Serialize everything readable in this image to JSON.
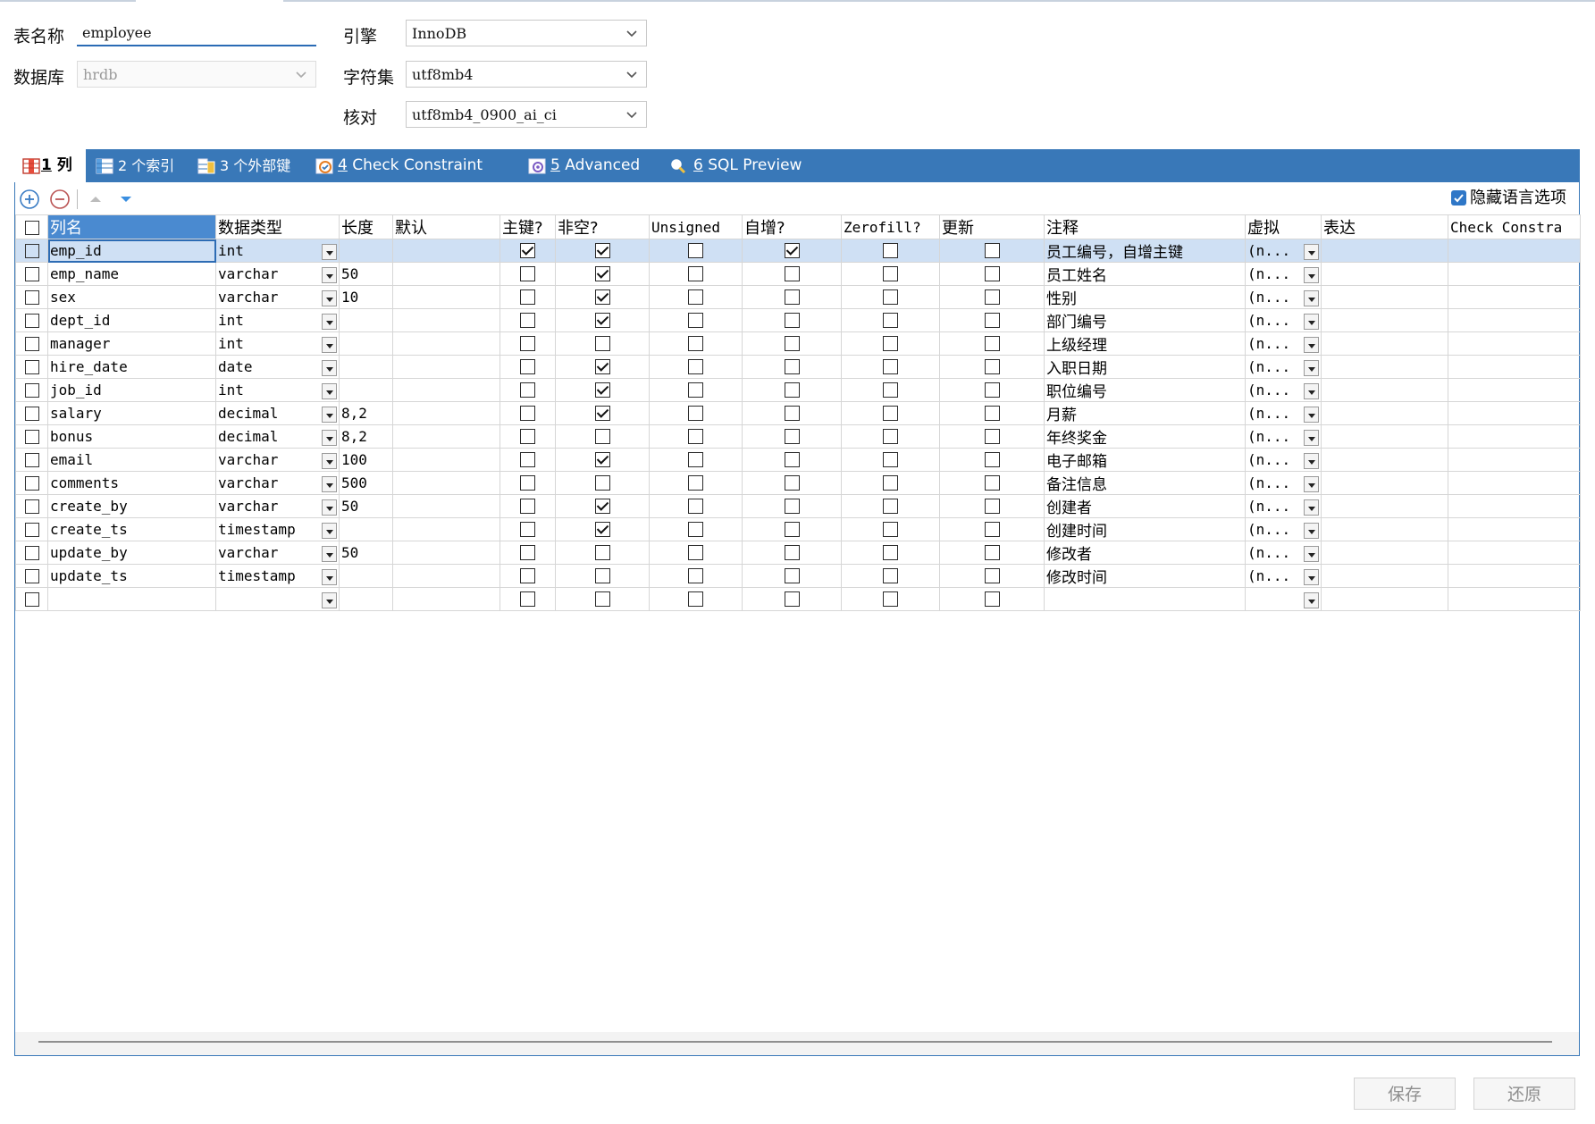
{
  "form": {
    "table_name_label": "表名称",
    "table_name_value": "employee",
    "database_label": "数据库",
    "database_value": "hrdb",
    "engine_label": "引擎",
    "engine_value": "InnoDB",
    "charset_label": "字符集",
    "charset_value": "utf8mb4",
    "collation_label": "核对",
    "collation_value": "utf8mb4_0900_ai_ci"
  },
  "tabs": [
    {
      "num": "1",
      "label": " 列",
      "icon": "columns-icon"
    },
    {
      "num": "2",
      "label": " 个索引",
      "icon": "index-icon"
    },
    {
      "num": "3",
      "label": " 个外部键",
      "icon": "foreign-key-icon"
    },
    {
      "num": "4",
      "label": " Check Constraint",
      "icon": "check-constraint-icon"
    },
    {
      "num": "5",
      "label": " Advanced",
      "icon": "advanced-icon"
    },
    {
      "num": "6",
      "label": " SQL Preview",
      "icon": "sql-preview-icon"
    }
  ],
  "toolbar": {
    "hide_lang_label": "隐藏语言选项",
    "hide_lang_checked": true
  },
  "columns_header": [
    "列名",
    "数据类型",
    "长度",
    "默认",
    "主键?",
    "非空?",
    "Unsigned",
    "自增?",
    "Zerofill?",
    "更新",
    "注释",
    "虚拟",
    "表达",
    "Check Constra"
  ],
  "rows": [
    {
      "name": "emp_id",
      "type": "int",
      "len": "",
      "def": "",
      "pk": true,
      "nn": true,
      "uns": false,
      "ai": true,
      "zf": false,
      "upd": false,
      "comment": "员工编号，自增主键",
      "virtual": "(n..."
    },
    {
      "name": "emp_name",
      "type": "varchar",
      "len": "50",
      "def": "",
      "pk": false,
      "nn": true,
      "uns": false,
      "ai": false,
      "zf": false,
      "upd": false,
      "comment": "员工姓名",
      "virtual": "(n..."
    },
    {
      "name": "sex",
      "type": "varchar",
      "len": "10",
      "def": "",
      "pk": false,
      "nn": true,
      "uns": false,
      "ai": false,
      "zf": false,
      "upd": false,
      "comment": "性别",
      "virtual": "(n..."
    },
    {
      "name": "dept_id",
      "type": "int",
      "len": "",
      "def": "",
      "pk": false,
      "nn": true,
      "uns": false,
      "ai": false,
      "zf": false,
      "upd": false,
      "comment": "部门编号",
      "virtual": "(n..."
    },
    {
      "name": "manager",
      "type": "int",
      "len": "",
      "def": "",
      "pk": false,
      "nn": false,
      "uns": false,
      "ai": false,
      "zf": false,
      "upd": false,
      "comment": "上级经理",
      "virtual": "(n..."
    },
    {
      "name": "hire_date",
      "type": "date",
      "len": "",
      "def": "",
      "pk": false,
      "nn": true,
      "uns": false,
      "ai": false,
      "zf": false,
      "upd": false,
      "comment": "入职日期",
      "virtual": "(n..."
    },
    {
      "name": "job_id",
      "type": "int",
      "len": "",
      "def": "",
      "pk": false,
      "nn": true,
      "uns": false,
      "ai": false,
      "zf": false,
      "upd": false,
      "comment": "职位编号",
      "virtual": "(n..."
    },
    {
      "name": "salary",
      "type": "decimal",
      "len": "8,2",
      "def": "",
      "pk": false,
      "nn": true,
      "uns": false,
      "ai": false,
      "zf": false,
      "upd": false,
      "comment": "月薪",
      "virtual": "(n..."
    },
    {
      "name": "bonus",
      "type": "decimal",
      "len": "8,2",
      "def": "",
      "pk": false,
      "nn": false,
      "uns": false,
      "ai": false,
      "zf": false,
      "upd": false,
      "comment": "年终奖金",
      "virtual": "(n..."
    },
    {
      "name": "email",
      "type": "varchar",
      "len": "100",
      "def": "",
      "pk": false,
      "nn": true,
      "uns": false,
      "ai": false,
      "zf": false,
      "upd": false,
      "comment": "电子邮箱",
      "virtual": "(n..."
    },
    {
      "name": "comments",
      "type": "varchar",
      "len": "500",
      "def": "",
      "pk": false,
      "nn": false,
      "uns": false,
      "ai": false,
      "zf": false,
      "upd": false,
      "comment": "备注信息",
      "virtual": "(n..."
    },
    {
      "name": "create_by",
      "type": "varchar",
      "len": "50",
      "def": "",
      "pk": false,
      "nn": true,
      "uns": false,
      "ai": false,
      "zf": false,
      "upd": false,
      "comment": "创建者",
      "virtual": "(n..."
    },
    {
      "name": "create_ts",
      "type": "timestamp",
      "len": "",
      "def": "",
      "pk": false,
      "nn": true,
      "uns": false,
      "ai": false,
      "zf": false,
      "upd": false,
      "comment": "创建时间",
      "virtual": "(n..."
    },
    {
      "name": "update_by",
      "type": "varchar",
      "len": "50",
      "def": "",
      "pk": false,
      "nn": false,
      "uns": false,
      "ai": false,
      "zf": false,
      "upd": false,
      "comment": "修改者",
      "virtual": "(n..."
    },
    {
      "name": "update_ts",
      "type": "timestamp",
      "len": "",
      "def": "",
      "pk": false,
      "nn": false,
      "uns": false,
      "ai": false,
      "zf": false,
      "upd": false,
      "comment": "修改时间",
      "virtual": "(n..."
    },
    {
      "name": "",
      "type": "",
      "len": "",
      "def": "",
      "pk": false,
      "nn": false,
      "uns": false,
      "ai": false,
      "zf": false,
      "upd": false,
      "comment": "",
      "virtual": ""
    }
  ],
  "buttons": {
    "save": "保存",
    "revert": "还原"
  },
  "colors": {
    "accent": "#3978b8",
    "selected_row": "#cfe0f4",
    "header_selected": "#4a8ad0"
  }
}
